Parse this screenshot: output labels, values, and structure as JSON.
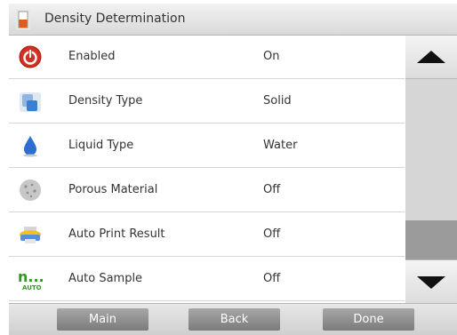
{
  "header": {
    "title": "Density Determination",
    "icon": "beaker-icon"
  },
  "rows": [
    {
      "label": "Enabled",
      "value": "On",
      "icon": "power-icon"
    },
    {
      "label": "Density Type",
      "value": "Solid",
      "icon": "solid-sample-icon"
    },
    {
      "label": "Liquid Type",
      "value": "Water",
      "icon": "water-drop-icon"
    },
    {
      "label": "Porous Material",
      "value": "Off",
      "icon": "porous-stone-icon"
    },
    {
      "label": "Auto Print Result",
      "value": "Off",
      "icon": "printer-icon"
    },
    {
      "label": "Auto Sample",
      "value": "Off",
      "icon": "auto-sample-icon"
    }
  ],
  "auto_sample_icon_text": {
    "dots": "n...",
    "auto": "AUTO"
  },
  "footer": {
    "main": "Main",
    "back": "Back",
    "done": "Done"
  },
  "colors": {
    "header": "#e2e2e2",
    "button": "#8e8e8e",
    "scroll_thumb": "#9b9b9b",
    "power_red": "#d42f24",
    "drop_blue": "#2c6fd1",
    "auto_green": "#2e9b1e"
  }
}
